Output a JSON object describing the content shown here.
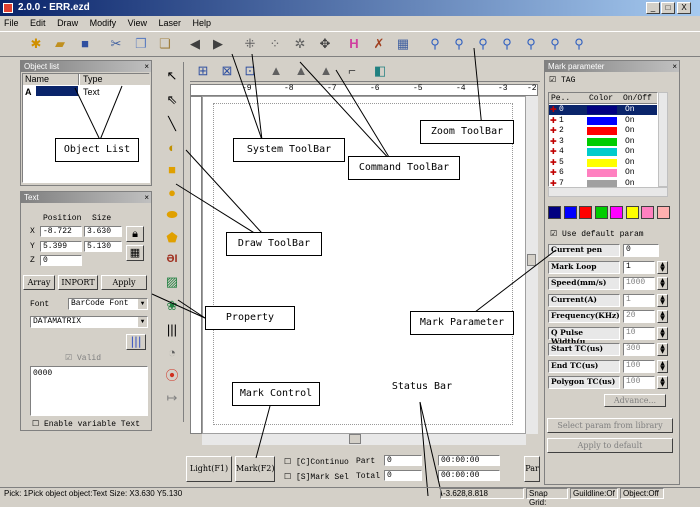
{
  "window": {
    "title": "2.0.0 - ERR.ezd",
    "minimize": "_",
    "maximize": "□",
    "close": "X"
  },
  "menu": [
    "File",
    "Edit",
    "Draw",
    "Modify",
    "View",
    "Laser",
    "Help"
  ],
  "toolbar_icons": [
    "new-icon",
    "open-icon",
    "save-icon",
    "cut-icon",
    "copy-icon",
    "paste-icon",
    "back-icon",
    "forward-icon",
    "group-icon",
    "ungroup-icon",
    "node-edit-icon",
    "combine-icon",
    "hatch-icon",
    "rotate-tool-icon",
    "calculator-icon",
    "zoom-icon",
    "zoom-in-icon",
    "zoom-fit-icon",
    "zoom-out-icon",
    "zoom-all-icon",
    "zoom-page-icon",
    "zoom-select-icon"
  ],
  "object_list": {
    "title": "Object list",
    "col_name": "Name",
    "col_type": "Type",
    "rows": [
      {
        "name": "A",
        "type": "Text"
      }
    ]
  },
  "text_panel": {
    "title": "Text",
    "position_label": "Position",
    "size_label": "Size",
    "x_label": "X",
    "y_label": "Y",
    "z_label": "Z",
    "x_pos": "-8.722",
    "y_pos": "5.399",
    "z_pos": "0",
    "x_size": "3.630",
    "y_size": "5.130",
    "array_btn": "Array",
    "import_btn": "INPORT",
    "apply_btn": "Apply",
    "font_label": "Font",
    "font_value": "BarCode Font",
    "barcode_value": "DATAMATRIX",
    "valid_label": "Valid",
    "text_value": "0000",
    "variable_label": "Enable variable Text"
  },
  "ruler_labels": [
    "-9",
    "-8",
    "-7",
    "-6",
    "-5",
    "-4",
    "-3",
    "-2"
  ],
  "mark_param": {
    "title": "Mark parameter",
    "tag_label": "TAG",
    "col_pen": "Pe..",
    "col_color": "Color",
    "col_onoff": "On/Off",
    "pens": [
      {
        "num": "0",
        "color": "#000080",
        "state": "On"
      },
      {
        "num": "1",
        "color": "#0000ff",
        "state": "On"
      },
      {
        "num": "2",
        "color": "#ff0000",
        "state": "On"
      },
      {
        "num": "3",
        "color": "#00cc00",
        "state": "On"
      },
      {
        "num": "4",
        "color": "#00cccc",
        "state": "On"
      },
      {
        "num": "5",
        "color": "#ffff00",
        "state": "On"
      },
      {
        "num": "6",
        "color": "#ff80c0",
        "state": "On"
      },
      {
        "num": "7",
        "color": "#a0a0a0",
        "state": "On"
      }
    ],
    "palette": [
      "#000080",
      "#0000ff",
      "#ff0000",
      "#00cc00",
      "#ff00ff",
      "#ffff00",
      "#ff80c0",
      "#ffb0b0"
    ],
    "use_default": "Use default param",
    "params": [
      {
        "label": "Current pen",
        "value": "0"
      },
      {
        "label": "Mark Loop",
        "value": "1"
      },
      {
        "label": "Speed(mm/s)",
        "value": "1000"
      },
      {
        "label": "Current(A)",
        "value": "1"
      },
      {
        "label": "Frequency(KHz)",
        "value": "20"
      },
      {
        "label": "Q Pulse Width(u",
        "value": "10"
      },
      {
        "label": "Start TC(us)",
        "value": "300"
      },
      {
        "label": "End TC(us)",
        "value": "100"
      },
      {
        "label": "Polygon TC(us)",
        "value": "100"
      }
    ],
    "advance_btn": "Advance...",
    "select_lib_btn": "Select param from library",
    "apply_default_btn": "Apply to default"
  },
  "mark_control": {
    "light_btn": "Light(F1)",
    "mark_btn": "Mark(F2)",
    "continue_label": "[C]Continuo",
    "part_label": "Part",
    "part_value": "0",
    "mark_sel_label": "[S]Mark Sel",
    "total_label": "Total",
    "total_value": "0",
    "time1": "00:00:00",
    "time2": "00:00:00",
    "par_btn": "Par"
  },
  "callouts": {
    "object_list": "Object List",
    "system_toolbar": "System ToolBar",
    "command_toolbar": "Command ToolBar",
    "zoom_toolbar": "Zoom ToolBar",
    "draw_toolbar": "Draw ToolBar",
    "property": "Property",
    "mark_parameter": "Mark Parameter",
    "mark_control": "Mark Control",
    "status_bar": "Status Bar"
  },
  "status": {
    "text": "Pick: 1Pick object object:Text Size: X3.630 Y5.130",
    "coords": "-3.628,8.818",
    "snap": "Snap Grid:",
    "guideline": "Guildline:Of",
    "object": "Object:Off"
  }
}
